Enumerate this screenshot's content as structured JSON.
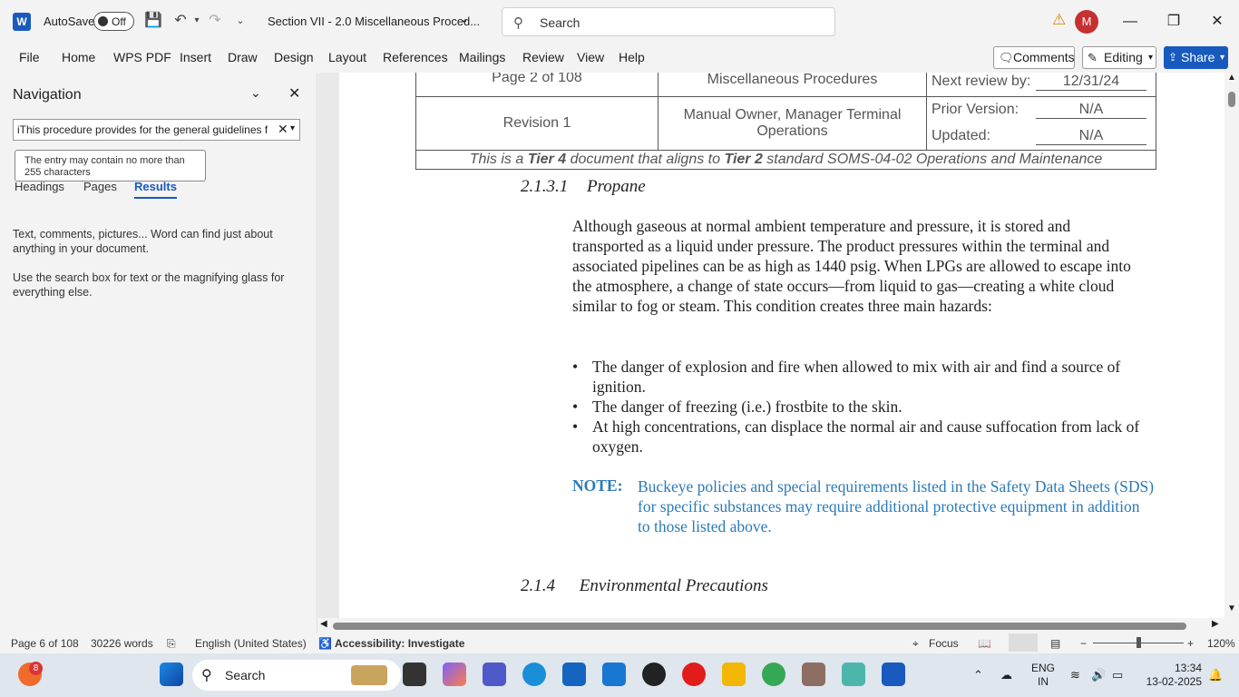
{
  "titlebar": {
    "autosave_label": "AutoSave",
    "autosave_state": "Off",
    "doc_title": "Section VII - 2.0 Miscellaneous Proced...",
    "search_placeholder": "Search",
    "avatar_initial": "M"
  },
  "menu": {
    "items": [
      "File",
      "Home",
      "WPS PDF",
      "Insert",
      "Draw",
      "Design",
      "Layout",
      "References",
      "Mailings",
      "Review",
      "View",
      "Help"
    ],
    "comments": "Comments",
    "editing": "Editing",
    "share": "Share"
  },
  "nav": {
    "title": "Navigation",
    "search_value": "iThis procedure provides for the general guidelines for",
    "tooltip": "The entry may contain no more than 255 characters",
    "tabs": [
      "Headings",
      "Pages",
      "Results"
    ],
    "help1": "Text, comments, pictures... Word can find just about anything in your document.",
    "help2": "Use the search box for text or the magnifying glass for everything else."
  },
  "document": {
    "header": {
      "page": "Page 2 of 108",
      "title": "Miscellaneous Procedures",
      "next_review_label": "Next review by:",
      "next_review": "12/31/24",
      "revision": "Revision 1",
      "owner": "Manual Owner, Manager Terminal Operations",
      "prior_label": "Prior Version:",
      "prior": "N/A",
      "updated_label": "Updated:",
      "updated": "N/A",
      "tier_line": "This is a Tier 4 document that aligns to Tier 2 standard SOMS-04-02 Operations and Maintenance",
      "tier_a": "This is a ",
      "tier_b": "Tier 4",
      "tier_c": " document that aligns to ",
      "tier_d": "Tier 2",
      "tier_e": " standard SOMS-04-02 Operations and Maintenance"
    },
    "section_num": "2.1.3.1",
    "section_title": "Propane",
    "paragraph": "Although gaseous at normal ambient temperature and pressure, it is stored and transported as a liquid under pressure. The product pressures within the terminal and associated pipelines can be as high as 1440 psig. When LPGs are allowed to escape into the atmosphere, a change of state occurs—from liquid to gas—creating a white cloud similar to fog or steam. This condition creates three main hazards:",
    "bullets": [
      "The danger of explosion and fire when allowed to mix with air and find a source of ignition.",
      "The danger of freezing (i.e.) frostbite to the skin.",
      "At high concentrations, can displace the normal air and cause suffocation from lack of oxygen."
    ],
    "note_label": "NOTE:",
    "note_text": "Buckeye policies and special requirements listed in the Safety Data Sheets (SDS) for specific substances may require additional protective equipment in addition to those listed above.",
    "next_section_num": "2.1.4",
    "next_section_title": "Environmental Precautions"
  },
  "status": {
    "page": "Page 6 of 108",
    "words": "30226 words",
    "language": "English (United States)",
    "accessibility": "Accessibility: Investigate",
    "focus": "Focus",
    "zoom": "120%",
    "zoom_level_percent": 120
  },
  "taskbar": {
    "search": "Search",
    "badge": "8",
    "lang_top": "ENG",
    "lang_bottom": "IN",
    "time": "13:34",
    "date": "13-02-2025"
  },
  "colors": {
    "accent": "#185abd",
    "note": "#2a7ab8",
    "avatar": "#c53030"
  }
}
